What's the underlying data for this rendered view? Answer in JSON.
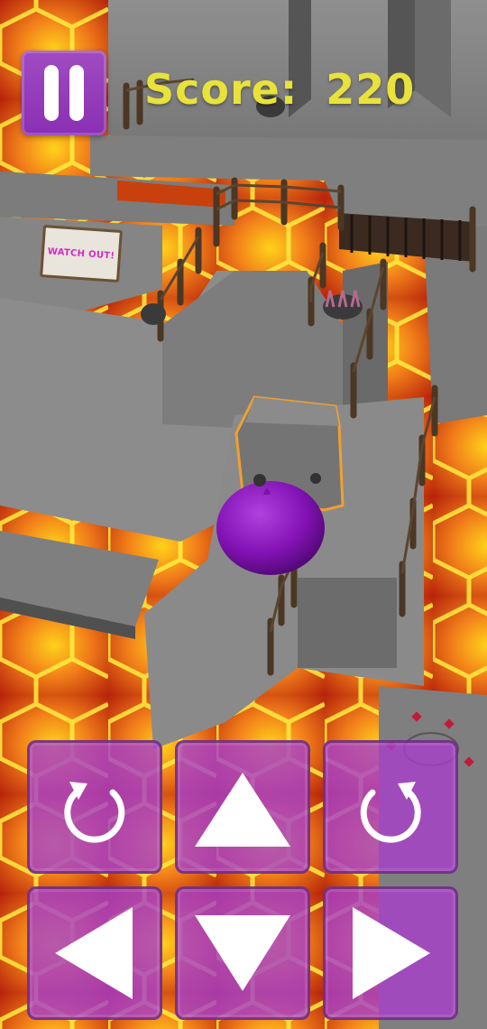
{
  "hud": {
    "score_label": "Score:",
    "score_value": "220"
  },
  "sign": {
    "text": "WATCH OUT!"
  },
  "controls": {
    "rotate_cw_icon": "rotate-clockwise-icon",
    "up_icon": "arrow-up-icon",
    "rotate_ccw_icon": "rotate-counterclockwise-icon",
    "left_icon": "arrow-left-icon",
    "down_icon": "arrow-down-icon",
    "right_icon": "arrow-right-icon"
  },
  "colors": {
    "lava": "#e8551a",
    "stone": "#8a8a8a",
    "button": "#a740c8",
    "player": "#8a16b8",
    "score_text": "#e8e23a"
  }
}
